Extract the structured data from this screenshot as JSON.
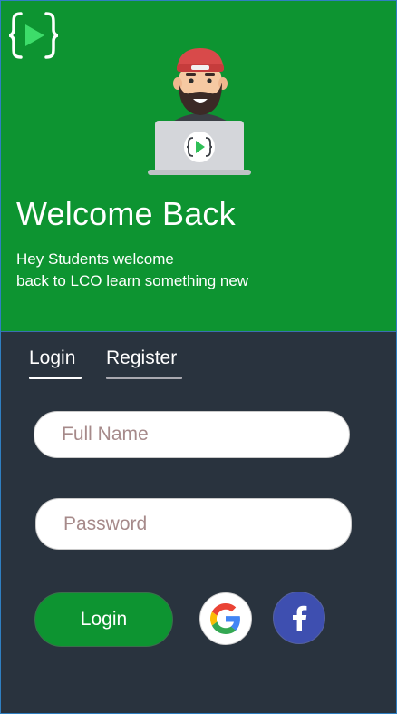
{
  "hero": {
    "title": "Welcome Back",
    "subtitle_line1": "Hey Students welcome",
    "subtitle_line2": "back to LCO learn something new",
    "logo_icon": "code-play-logo-icon",
    "illustration": "developer-laptop-illustration"
  },
  "tabs": [
    {
      "label": "Login",
      "active": true
    },
    {
      "label": "Register",
      "active": false
    }
  ],
  "form": {
    "name_placeholder": "Full Name",
    "name_value": "",
    "password_placeholder": "Password",
    "password_value": "",
    "login_label": "Login"
  },
  "social": {
    "google_icon": "google-icon",
    "facebook_icon": "facebook-icon"
  },
  "colors": {
    "hero_green": "#0d9431",
    "body_dark": "#29333e",
    "facebook_blue": "#3e4fb0",
    "tab_active_underline": "#ffffff",
    "tab_inactive_underline": "#a9a9b0"
  }
}
